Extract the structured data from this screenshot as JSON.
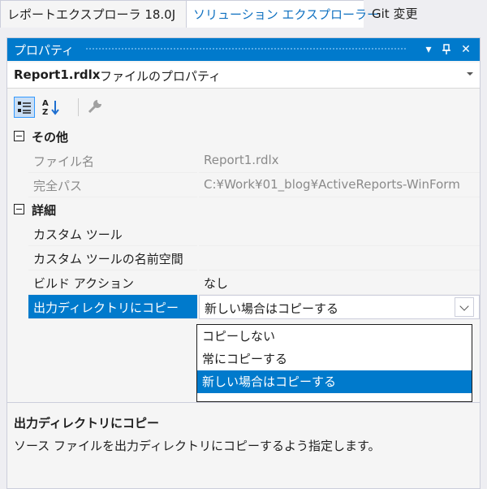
{
  "tabs": [
    {
      "label": "レポートエクスプローラ 18.0J"
    },
    {
      "label": "ソリューション エクスプローラー"
    },
    {
      "label": "Git 変更"
    }
  ],
  "panel": {
    "title": "プロパティ",
    "controls": {
      "dropdown": "▾",
      "pin": "ᛘ",
      "close": "✕"
    }
  },
  "selector": {
    "name": "Report1.rdlx",
    "desc": "ファイルのプロパティ"
  },
  "toolbar": {
    "icons": [
      "categorized-icon",
      "alphabetical-icon",
      "property-pages-icon"
    ]
  },
  "grid": {
    "categories": [
      {
        "label": "その他",
        "props": [
          {
            "key": "ファイル名",
            "value": "Report1.rdlx",
            "disabled": true
          },
          {
            "key": "完全パス",
            "value": "C:¥Work¥01_blog¥ActiveReports-WinForm",
            "disabled": true
          }
        ]
      },
      {
        "label": "詳細",
        "props": [
          {
            "key": "カスタム ツール",
            "value": ""
          },
          {
            "key": "カスタム ツールの名前空間",
            "value": ""
          },
          {
            "key": "ビルド アクション",
            "value": "なし"
          },
          {
            "key": "出力ディレクトリにコピー",
            "value": "新しい場合はコピーする",
            "selected": true
          }
        ]
      }
    ]
  },
  "dropdown": {
    "options": [
      "コピーしない",
      "常にコピーする",
      "新しい場合はコピーする"
    ],
    "selected_index": 2
  },
  "description": {
    "title": "出力ディレクトリにコピー",
    "text": "ソース ファイルを出力ディレクトリにコピーするよう指定します。"
  },
  "colors": {
    "accent": "#007acc",
    "background": "#eeeef2"
  }
}
